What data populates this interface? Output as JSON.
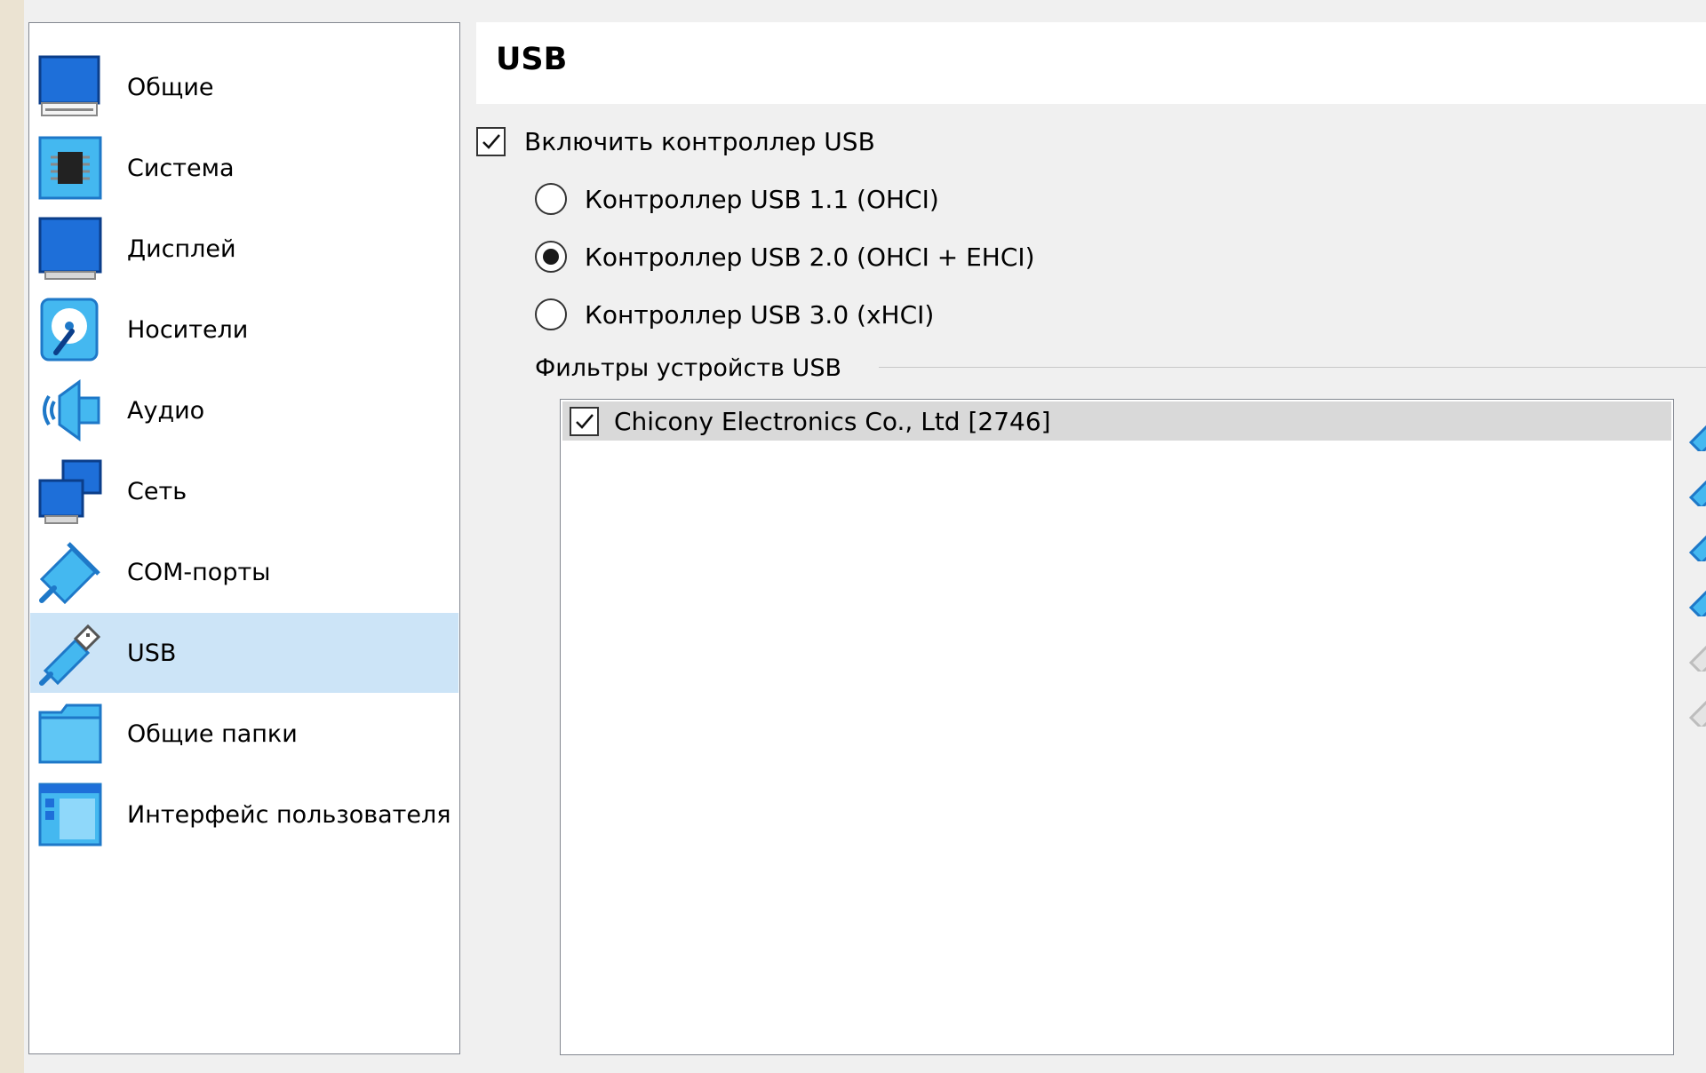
{
  "sidebar": {
    "items": [
      {
        "label": "Общие",
        "icon": "general-icon"
      },
      {
        "label": "Система",
        "icon": "system-chip-icon"
      },
      {
        "label": "Дисплей",
        "icon": "display-icon"
      },
      {
        "label": "Носители",
        "icon": "storage-disk-icon"
      },
      {
        "label": "Аудио",
        "icon": "audio-speaker-icon"
      },
      {
        "label": "Сеть",
        "icon": "network-icon"
      },
      {
        "label": "COM-порты",
        "icon": "serial-port-icon"
      },
      {
        "label": "USB",
        "icon": "usb-icon",
        "selected": true
      },
      {
        "label": "Общие папки",
        "icon": "shared-folder-icon"
      },
      {
        "label": "Интерфейс пользователя",
        "icon": "user-interface-icon"
      }
    ]
  },
  "header": {
    "title": "USB"
  },
  "usb": {
    "enable_label": "Включить контроллер USB",
    "enable_checked": true,
    "controllers": [
      {
        "label": "Контроллер USB 1.1 (OHCI)",
        "selected": false
      },
      {
        "label": "Контроллер USB 2.0 (OHCI + EHCI)",
        "selected": true
      },
      {
        "label": "Контроллер USB 3.0 (xHCI)",
        "selected": false
      }
    ],
    "filters_label": "Фильтры устройств USB",
    "filters": [
      {
        "name": "Chicony Electronics Co., Ltd  [2746]",
        "enabled": true
      }
    ],
    "tools": [
      {
        "icon": "usb-add-empty-filter-icon",
        "enabled": true
      },
      {
        "icon": "usb-add-filter-from-device-icon",
        "enabled": true
      },
      {
        "icon": "usb-edit-filter-icon",
        "enabled": true
      },
      {
        "icon": "usb-remove-filter-icon",
        "enabled": true
      },
      {
        "icon": "usb-move-up-icon",
        "enabled": false
      },
      {
        "icon": "usb-move-down-icon",
        "enabled": false
      }
    ]
  },
  "colors": {
    "selection": "#cce4f7",
    "accent_blue": "#1e6fd9",
    "window_bg": "#f0f0f0",
    "desktop_bg": "#ebe3d2"
  }
}
